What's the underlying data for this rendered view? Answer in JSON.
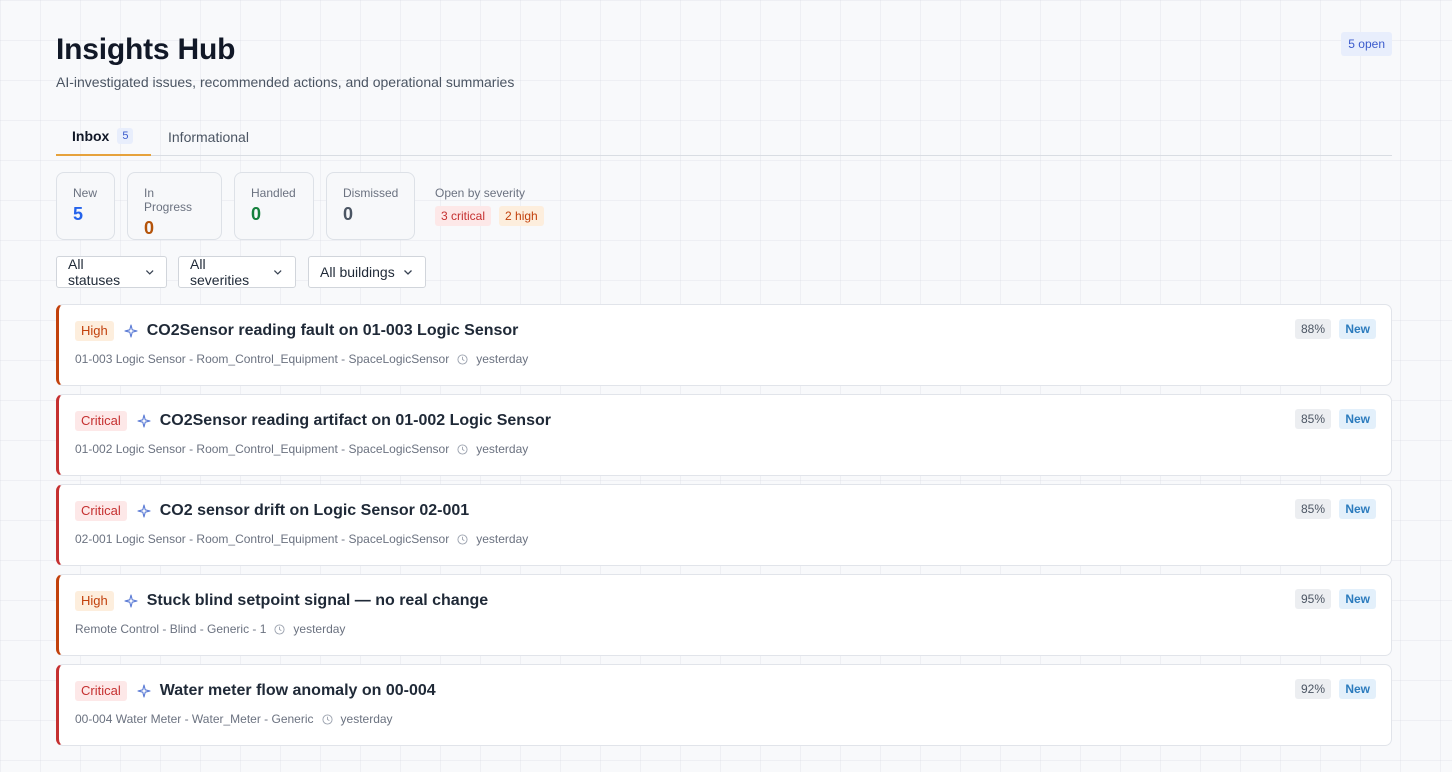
{
  "header": {
    "title": "Insights Hub",
    "subtitle": "AI-investigated issues, recommended actions, and operational summaries",
    "open_badge": "5 open"
  },
  "tabs": [
    {
      "label": "Inbox",
      "count": "5",
      "active": true
    },
    {
      "label": "Informational",
      "active": false
    }
  ],
  "stats": [
    {
      "label": "New",
      "value": "5",
      "color": "#2563eb"
    },
    {
      "label": "In Progress",
      "value": "0",
      "color": "#b45309"
    },
    {
      "label": "Handled",
      "value": "0",
      "color": "#15803d"
    },
    {
      "label": "Dismissed",
      "value": "0",
      "color": "#4b5563"
    }
  ],
  "severity_summary": {
    "label": "Open by severity",
    "critical": "3 critical",
    "high": "2 high",
    "critical_color": "#c53030",
    "high_color": "#c2410c"
  },
  "filters": [
    "All statuses",
    "All severities",
    "All buildings"
  ],
  "insights": [
    {
      "severity": "High",
      "title": "CO2Sensor reading fault on 01-003 Logic Sensor",
      "meta": "01-003 Logic Sensor - Room_Control_Equipment - SpaceLogicSensor",
      "time": "yesterday",
      "confidence": "88%",
      "status": "New"
    },
    {
      "severity": "Critical",
      "title": "CO2Sensor reading artifact on 01-002 Logic Sensor",
      "meta": "01-002 Logic Sensor - Room_Control_Equipment - SpaceLogicSensor",
      "time": "yesterday",
      "confidence": "85%",
      "status": "New"
    },
    {
      "severity": "Critical",
      "title": "CO2 sensor drift on Logic Sensor 02-001",
      "meta": "02-001 Logic Sensor - Room_Control_Equipment - SpaceLogicSensor",
      "time": "yesterday",
      "confidence": "85%",
      "status": "New"
    },
    {
      "severity": "High",
      "title": "Stuck blind setpoint signal — no real change",
      "meta": "Remote Control - Blind - Generic - 1",
      "time": "yesterday",
      "confidence": "95%",
      "status": "New"
    },
    {
      "severity": "Critical",
      "title": "Water meter flow anomaly on 00-004",
      "meta": "00-004 Water Meter - Water_Meter - Generic",
      "time": "yesterday",
      "confidence": "92%",
      "status": "New"
    }
  ],
  "icons": {
    "insight": "sparkle-icon",
    "time": "clock-icon",
    "filter": "chevron-down-icon"
  }
}
